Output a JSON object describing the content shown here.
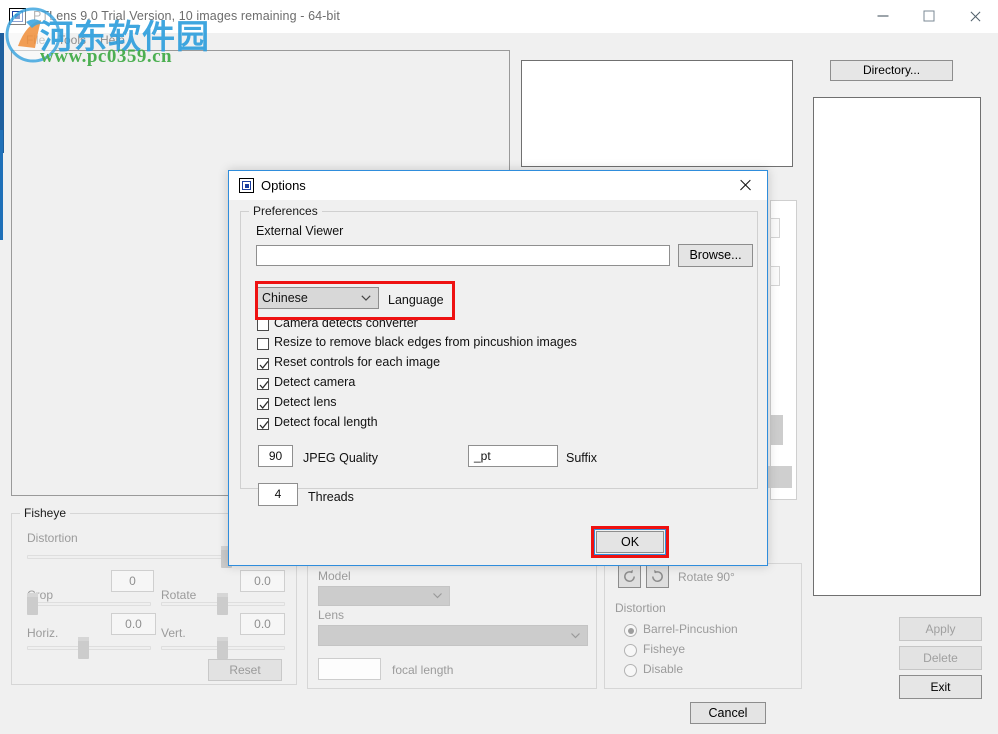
{
  "window": {
    "title": "PTLens 9.0 Trial Version, 10 images remaining - 64-bit",
    "icon": "app-icon",
    "controls": {
      "minimize": "–",
      "maximize": "□",
      "close": "✕"
    }
  },
  "menu": {
    "items": [
      {
        "label": "File"
      },
      {
        "label": "Tools"
      },
      {
        "label": "Help"
      }
    ]
  },
  "watermark": {
    "cn_text": "河东软件园",
    "url": "www.pc0359.cn"
  },
  "right_panel": {
    "directory_button": "Directory...",
    "actions": [
      {
        "label": "Apply",
        "enabled": false
      },
      {
        "label": "Delete",
        "enabled": false
      },
      {
        "label": "Exit",
        "enabled": true
      }
    ]
  },
  "fisheye": {
    "legend": "Fisheye",
    "distortion_label": "Distortion",
    "crop_label": "Crop",
    "crop_value": "0",
    "rotate_label": "Rotate",
    "rotate_value": "0.0",
    "horiz_label": "Horiz.",
    "horiz_value": "0.0",
    "vert_label": "Vert.",
    "vert_value": "0.0",
    "reset_label": "Reset"
  },
  "camera": {
    "model_label": "Model",
    "model_value": "",
    "lens_label": "Lens",
    "lens_value": "",
    "focal_length_label": "focal length",
    "focal_length_value": ""
  },
  "distortion": {
    "rotate90_label": "Rotate 90°",
    "group_label": "Distortion",
    "options": [
      {
        "label": "Barrel-Pincushion",
        "selected": true
      },
      {
        "label": "Fisheye",
        "selected": false
      },
      {
        "label": "Disable",
        "selected": false
      }
    ]
  },
  "dialog": {
    "title": "Options",
    "close_glyph": "✕",
    "group_legend": "Preferences",
    "external_viewer_label": "External Viewer",
    "external_viewer_value": "",
    "external_viewer_placeholder": "",
    "browse_label": "Browse...",
    "language_value": "Chinese",
    "language_label": "Language",
    "checkboxes": [
      {
        "label": "Camera detects converter",
        "checked": false
      },
      {
        "label": "Resize to remove black edges from pincushion images",
        "checked": false
      },
      {
        "label": "Reset controls for each image",
        "checked": true
      },
      {
        "label": "Detect camera",
        "checked": true
      },
      {
        "label": "Detect lens",
        "checked": true
      },
      {
        "label": "Detect focal length",
        "checked": true
      }
    ],
    "jpeg_quality_value": "90",
    "jpeg_quality_label": "JPEG Quality",
    "suffix_value": "_pt",
    "suffix_label": "Suffix",
    "threads_value": "4",
    "threads_label": "Threads",
    "ok_label": "OK",
    "cancel_label": "Cancel"
  },
  "colors": {
    "accent": "#2f8ddc",
    "annotation": "#ee1111",
    "window_bg": "#f0f0f0",
    "watermark_blue": "#2f9fdd",
    "watermark_green": "#3faa45"
  }
}
